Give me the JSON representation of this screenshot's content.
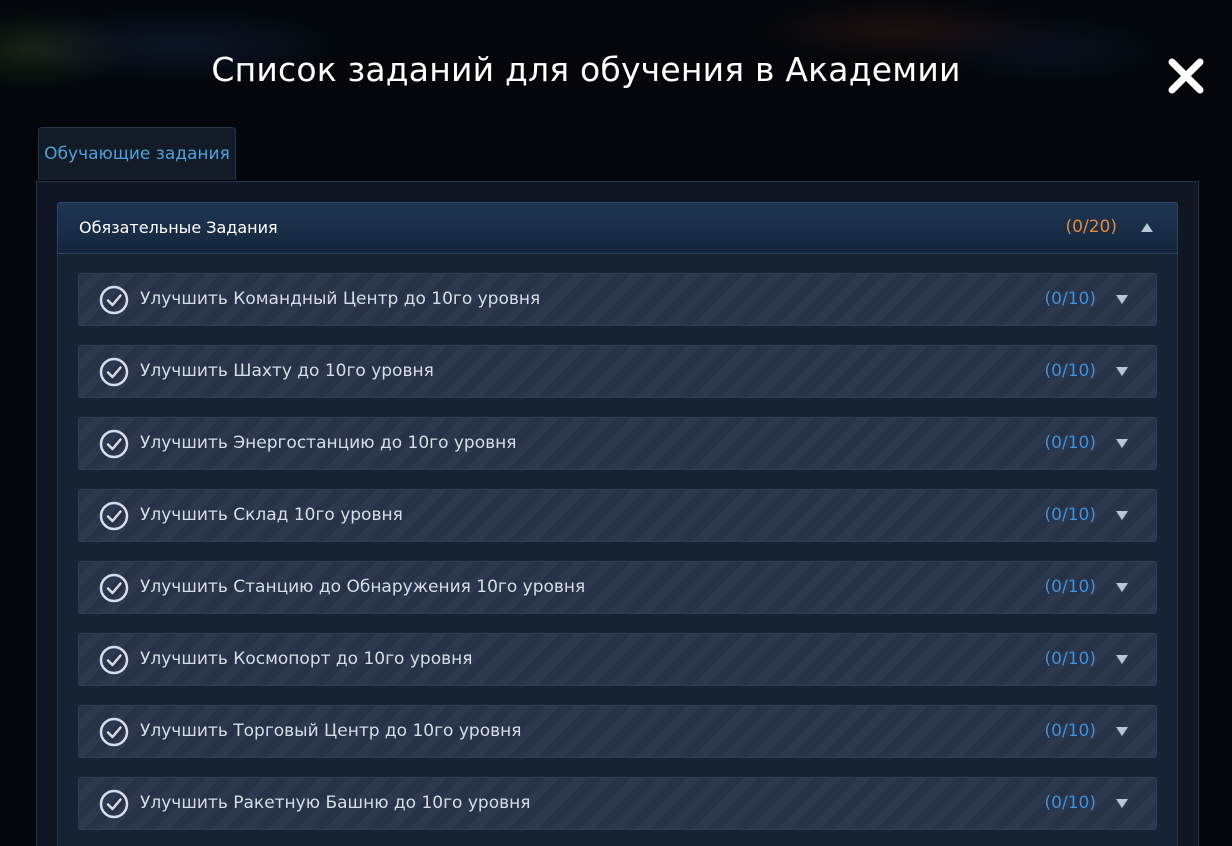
{
  "modal": {
    "title": "Список заданий для обучения в Академии",
    "close_icon": "close-icon"
  },
  "tabs": [
    {
      "label": "Обучающие задания",
      "active": true
    }
  ],
  "section": {
    "title": "Обязательные Задания",
    "count": "(0/20)",
    "expanded": true
  },
  "tasks": [
    {
      "label": "Улучшить Командный Центр до 10го уровня",
      "count": "(0/10)"
    },
    {
      "label": "Улучшить Шахту до 10го уровня",
      "count": "(0/10)"
    },
    {
      "label": "Улучшить Энергостанцию до 10го уровня",
      "count": "(0/10)"
    },
    {
      "label": "Улучшить Склад 10го уровня",
      "count": "(0/10)"
    },
    {
      "label": "Улучшить Станцию до Обнаружения 10го уровня",
      "count": "(0/10)"
    },
    {
      "label": "Улучшить Космопорт до 10го уровня",
      "count": "(0/10)"
    },
    {
      "label": "Улучшить Торговый Центр до 10го уровня",
      "count": "(0/10)"
    },
    {
      "label": "Улучшить Ракетную Башню до 10го уровня",
      "count": "(0/10)"
    }
  ],
  "colors": {
    "accent_blue": "#3d8fd6",
    "accent_orange": "#e8883a",
    "text": "#d6dde6"
  }
}
